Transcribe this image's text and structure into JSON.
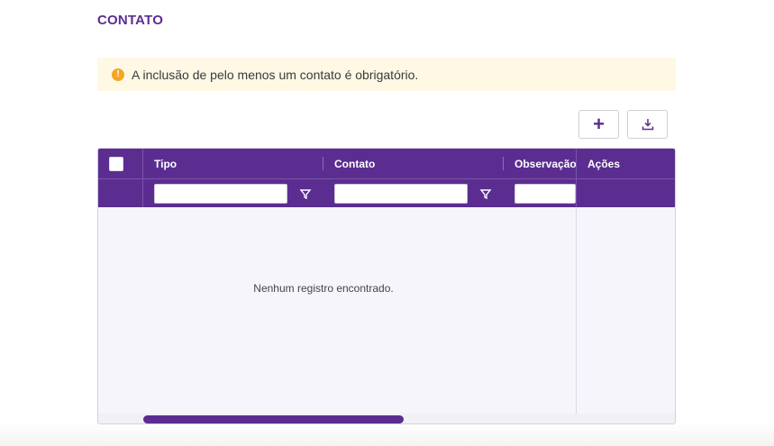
{
  "section": {
    "title": "CONTATO"
  },
  "warning": {
    "icon": "exclamation-circle-icon",
    "message": "A inclusão de pelo menos um contato é obrigatório."
  },
  "toolbar": {
    "add_icon": "plus-icon",
    "add_glyph": "+",
    "export_icon": "download-icon"
  },
  "grid": {
    "columns": [
      {
        "key": "tipo",
        "label": "Tipo",
        "filterable": true
      },
      {
        "key": "contato",
        "label": "Contato",
        "filterable": true
      },
      {
        "key": "observacao",
        "label": "Observação",
        "filterable": true
      },
      {
        "key": "acoes",
        "label": "Ações",
        "filterable": false
      }
    ],
    "filters": {
      "tipo": "",
      "contato": "",
      "observacao": ""
    },
    "empty_message": "Nenhum registro encontrado."
  },
  "colors": {
    "primary": "#5b2d91",
    "warning_bg": "#fef8e5",
    "warning_icon": "#f5a623",
    "grid_body_bg": "#f7f5fc"
  }
}
